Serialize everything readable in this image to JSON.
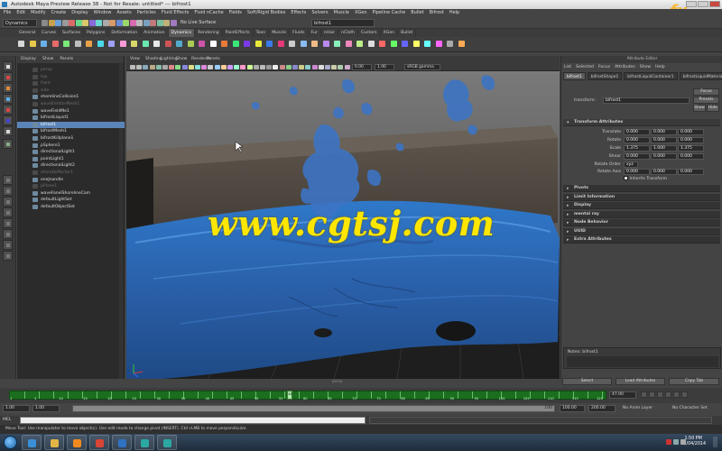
{
  "window": {
    "title": "Autodesk Maya Preview Release 38 - Not for Resale: untitled*   ---   bifrost1"
  },
  "menubar": [
    "File",
    "Edit",
    "Modify",
    "Create",
    "Display",
    "Window",
    "Assets",
    "Particles",
    "Fluid Effects",
    "Fluid nCache",
    "Fields",
    "Soft/Rigid Bodies",
    "Effects",
    "Solvers",
    "Muscle",
    "XGen",
    "Pipeline Cache",
    "Bullet",
    "Bifrost",
    "Help"
  ],
  "statusline": {
    "mode": "Dynamics",
    "live_surface": "No Live Surface",
    "selection_field": "bifrost1"
  },
  "shelf_tabs": [
    {
      "label": "General",
      "active": false
    },
    {
      "label": "Curves",
      "active": false
    },
    {
      "label": "Surfaces",
      "active": false
    },
    {
      "label": "Polygons",
      "active": false
    },
    {
      "label": "Deformation",
      "active": false
    },
    {
      "label": "Animation",
      "active": false
    },
    {
      "label": "Dynamics",
      "active": true
    },
    {
      "label": "Rendering",
      "active": false
    },
    {
      "label": "PaintEffects",
      "active": false
    },
    {
      "label": "Toon",
      "active": false
    },
    {
      "label": "Muscle",
      "active": false
    },
    {
      "label": "Fluids",
      "active": false
    },
    {
      "label": "Fur",
      "active": false
    },
    {
      "label": "nHair",
      "active": false
    },
    {
      "label": "nCloth",
      "active": false
    },
    {
      "label": "Custom",
      "active": false
    },
    {
      "label": "XGen",
      "active": false
    },
    {
      "label": "Bullet",
      "active": false
    }
  ],
  "outliner": {
    "menu": [
      "Display",
      "Show",
      "Panels"
    ],
    "items": [
      {
        "label": "persp",
        "dim": true,
        "selected": false
      },
      {
        "label": "top",
        "dim": true,
        "selected": false
      },
      {
        "label": "front",
        "dim": true,
        "selected": false
      },
      {
        "label": "side",
        "dim": true,
        "selected": false
      },
      {
        "label": "shorelineCollision1",
        "dim": false,
        "selected": false
      },
      {
        "label": "waveEmitterMesh1",
        "dim": true,
        "selected": false
      },
      {
        "label": "waveFieldMe1",
        "dim": false,
        "selected": false
      },
      {
        "label": "bifrostLiquid1",
        "dim": false,
        "selected": false
      },
      {
        "label": "bifrost1",
        "dim": false,
        "selected": true
      },
      {
        "label": "bifrostMesh1",
        "dim": false,
        "selected": false
      },
      {
        "label": "bifrostKillplane1",
        "dim": false,
        "selected": false
      },
      {
        "label": "pSphere1",
        "dim": false,
        "selected": false
      },
      {
        "label": "directionalLight1",
        "dim": false,
        "selected": false
      },
      {
        "label": "pointLight1",
        "dim": false,
        "selected": false
      },
      {
        "label": "directionalLight2",
        "dim": false,
        "selected": false
      },
      {
        "label": "shoreDeflector1",
        "dim": true,
        "selected": false
      },
      {
        "label": "oneJnandle",
        "dim": false,
        "selected": false
      },
      {
        "label": "pPlane1",
        "dim": true,
        "selected": false
      },
      {
        "label": "waveFanelShorelineCam",
        "dim": false,
        "selected": false
      },
      {
        "label": "defaultLightSet",
        "dim": false,
        "selected": false
      },
      {
        "label": "defaultObjectSet",
        "dim": false,
        "selected": false
      }
    ]
  },
  "panel": {
    "menu": [
      "View",
      "Shading",
      "Lighting",
      "Show",
      "Renderer",
      "Panels"
    ],
    "field1": "0.00",
    "field2": "1.00",
    "gamma": "sRGB gamma"
  },
  "viewport": {
    "watermark": "www.cgtsj.com",
    "camera_label": "persp"
  },
  "logo": {
    "text": "fx",
    "text2": "phd"
  },
  "attribute_editor": {
    "title": "Attribute Editor",
    "menu": [
      "List",
      "Selected",
      "Focus",
      "Attributes",
      "Show",
      "Help"
    ],
    "tabs": [
      {
        "label": "bifrost1",
        "active": true
      },
      {
        "label": "bifrostShape1",
        "active": false
      },
      {
        "label": "bifrostLiquidContainer1",
        "active": false
      },
      {
        "label": "bifrostLiquidMaterial1",
        "active": false
      }
    ],
    "transform_label": "transform:",
    "transform_value": "bifrost1",
    "buttons": {
      "focus": "Focus",
      "presets": "Presets",
      "show": "Show",
      "hide": "Hide"
    },
    "section_transform": "Transform Attributes",
    "rows": [
      {
        "label": "Translate",
        "v": [
          "0.000",
          "0.000",
          "0.000"
        ]
      },
      {
        "label": "Rotate",
        "v": [
          "0.000",
          "0.000",
          "0.000"
        ]
      },
      {
        "label": "Scale",
        "v": [
          "1.375",
          "1.000",
          "1.375"
        ]
      },
      {
        "label": "Shear",
        "v": [
          "0.000",
          "0.000",
          "0.000"
        ]
      }
    ],
    "rotate_order_label": "Rotate Order",
    "rotate_order_value": "xyz",
    "rotate_axis_label": "Rotate Axis",
    "rotate_axis": [
      "0.000",
      "0.000",
      "0.000"
    ],
    "inherits_transform": "Inherits Transform",
    "sections": [
      "Pivots",
      "Limit Information",
      "Display",
      "mental ray",
      "Node Behavior",
      "UUID",
      "Extra Attributes"
    ],
    "notes_label": "Notes:  bifrost1",
    "footer": {
      "select": "Select",
      "load": "Load Attributes",
      "copy": "Copy Tab"
    }
  },
  "timeline": {
    "labels": [
      "1",
      "5",
      "10",
      "15",
      "20",
      "25",
      "30",
      "35",
      "40",
      "45",
      "50",
      "55",
      "60",
      "65",
      "70",
      "75",
      "80",
      "85",
      "90",
      "95",
      "100",
      "105",
      "110",
      "115",
      "120"
    ],
    "current_marker": "48",
    "current_frame": "47.00",
    "current_fraction": 0.47
  },
  "range": {
    "start": "1.00",
    "start2": "1.00",
    "slider_label": "100",
    "end": "100.00",
    "end2": "200.00",
    "anim_layer": "No Anim Layer",
    "char_set": "No Character Set"
  },
  "command_line": {
    "label": "MEL"
  },
  "help_line": "Move Tool: Use manipulator to move object(s). Use edit mode to change pivot (INSERT). Ctrl+LMB to move perpendicular.",
  "taskbar": {
    "clock_time": "1:50 PM",
    "clock_date": "12/04/2014",
    "apps": [
      {
        "name": "ie-icon",
        "color": "#3a8fd6"
      },
      {
        "name": "explorer-icon",
        "color": "#e3b545"
      },
      {
        "name": "media-player-icon",
        "color": "#f08a1e"
      },
      {
        "name": "chrome-icon",
        "color": "#d94435"
      },
      {
        "name": "outlook-icon",
        "color": "#2e72c2"
      },
      {
        "name": "maya-icon",
        "color": "#2aa8a1"
      },
      {
        "name": "maya-icon-2",
        "color": "#2aa8a1"
      }
    ]
  },
  "colors": {
    "accent_select": "#5b84b8",
    "timeline_green": "#1a6e1e",
    "watermark": "#ffe600",
    "water_blue": "#2f66b8"
  }
}
